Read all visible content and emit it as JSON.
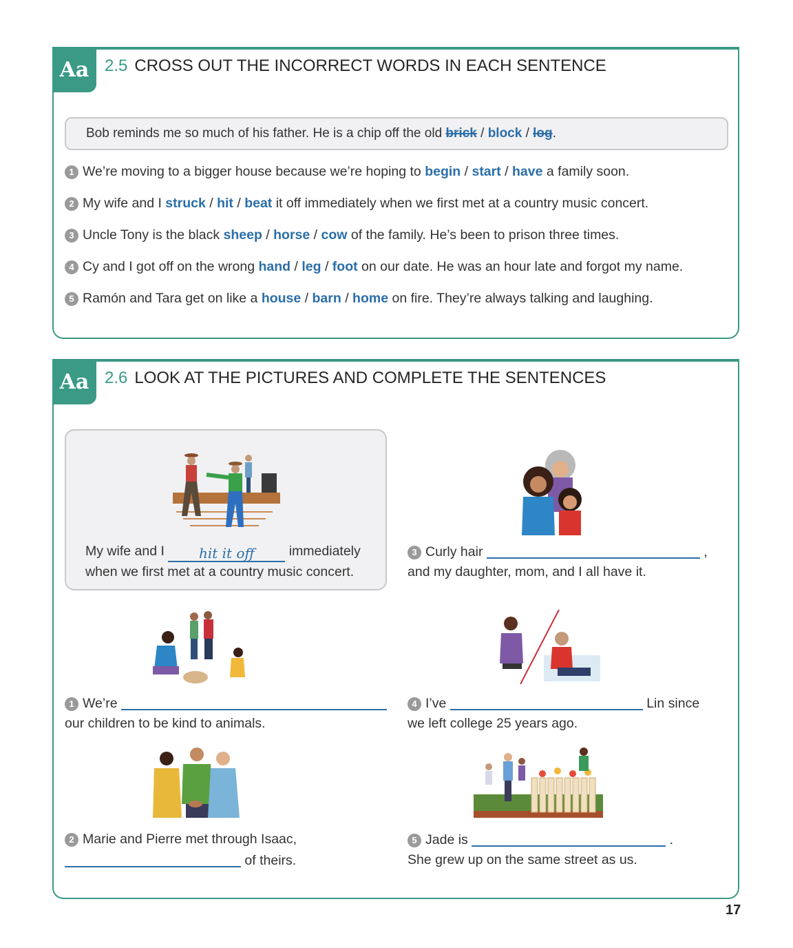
{
  "ex25": {
    "badge": "Aa",
    "number": "2.5",
    "title": "CROSS OUT THE INCORRECT WORDS IN EACH SENTENCE",
    "example": {
      "pre": "Bob reminds me so much of his father. He is a chip off the old ",
      "opt1": "brick",
      "sep1": " / ",
      "opt2": "block",
      "sep2": " / ",
      "opt3": "log",
      "post": "."
    },
    "items": [
      {
        "num": "1",
        "pre": "We’re moving to a bigger house because we’re hoping to ",
        "o1": "begin",
        "o2": "start",
        "o3": "have",
        "post": " a family soon."
      },
      {
        "num": "2",
        "pre": "My wife and I ",
        "o1": "struck",
        "o2": "hit",
        "o3": "beat",
        "post": " it off immediately when we first met at a country music concert."
      },
      {
        "num": "3",
        "pre": "Uncle Tony is the black ",
        "o1": "sheep",
        "o2": "horse",
        "o3": "cow",
        "post": " of the family. He’s been to prison three times."
      },
      {
        "num": "4",
        "pre": "Cy and I got off on the wrong ",
        "o1": "hand",
        "o2": "leg",
        "o3": "foot",
        "post": " on our date. He was an hour late and forgot my name."
      },
      {
        "num": "5",
        "pre": "Ramón and Tara get on like a ",
        "o1": "house",
        "o2": "barn",
        "o3": "home",
        "post": " on fire. They’re always talking and laughing."
      }
    ],
    "sep": " / "
  },
  "ex26": {
    "badge": "Aa",
    "number": "2.6",
    "title": "LOOK AT THE PICTURES AND COMPLETE THE SENTENCES",
    "example": {
      "line1_pre": "My wife and I",
      "answer": "hit it off",
      "line1_post": "immediately",
      "line2": "when we first met at a country music concert."
    },
    "items": [
      {
        "num": "1",
        "line1_pre": "We’re",
        "line1_post": "",
        "line2": "our children to be kind to animals."
      },
      {
        "num": "2",
        "line1_pre": "Marie and Pierre met through Isaac,",
        "line1_post": "",
        "line2": "of theirs."
      },
      {
        "num": "3",
        "line1_pre": "Curly hair",
        "line1_post": ",",
        "line2": "and my daughter, mom, and I all have it."
      },
      {
        "num": "4",
        "line1_pre": "I’ve",
        "line1_post": "Lin since",
        "line2": "we left college 25 years ago."
      },
      {
        "num": "5",
        "line1_pre": "Jade is",
        "line1_post": ".",
        "line2": "She grew up on the same street as us."
      }
    ]
  },
  "page": {
    "number": "17"
  },
  "colors": {
    "teal": "#3a9a86",
    "blue": "#2b6ea9",
    "box_bg": "#f1f1f3",
    "box_border": "#c9c9cc"
  },
  "illustrations": {
    "example": "country-dance-illustration",
    "item1": "family-with-rabbit-illustration",
    "item2": "introduction-handshake-illustration",
    "item3": "curly-hair-family-illustration",
    "item4": "phone-friends-illustration",
    "item5": "neighbor-garden-illustration"
  }
}
